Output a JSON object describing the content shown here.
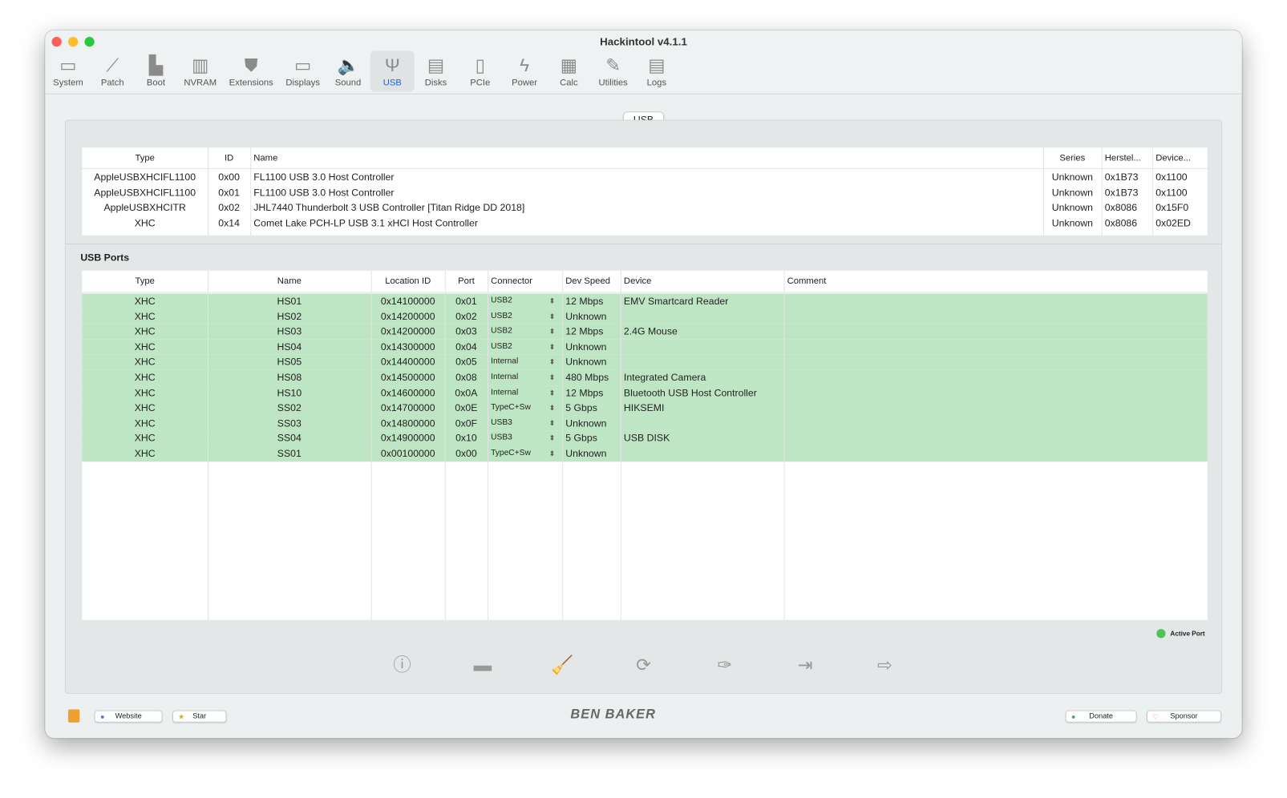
{
  "window": {
    "title": "Hackintool v4.1.1"
  },
  "toolbar": [
    {
      "label": "System",
      "icon": "system-icon",
      "g": "▭"
    },
    {
      "label": "Patch",
      "icon": "bandage-icon",
      "g": "⟋"
    },
    {
      "label": "Boot",
      "icon": "boot-icon",
      "g": "▙"
    },
    {
      "label": "NVRAM",
      "icon": "nvram-icon",
      "g": "▥"
    },
    {
      "label": "Extensions",
      "icon": "extensions-icon",
      "g": "⛊"
    },
    {
      "label": "Displays",
      "icon": "display-icon",
      "g": "▭"
    },
    {
      "label": "Sound",
      "icon": "speaker-icon",
      "g": "🔈"
    },
    {
      "label": "USB",
      "icon": "usb-icon",
      "g": "Ψ"
    },
    {
      "label": "Disks",
      "icon": "disk-icon",
      "g": "▤"
    },
    {
      "label": "PCIe",
      "icon": "pcie-icon",
      "g": "▯"
    },
    {
      "label": "Power",
      "icon": "power-icon",
      "g": "ϟ"
    },
    {
      "label": "Calc",
      "icon": "calculator-icon",
      "g": "▦"
    },
    {
      "label": "Utilities",
      "icon": "wrench-icon",
      "g": "✎"
    },
    {
      "label": "Logs",
      "icon": "logs-icon",
      "g": "▤"
    }
  ],
  "selected_tool": "USB",
  "tab_label": "USB",
  "controllers": {
    "columns": [
      "Type",
      "ID",
      "Name",
      "Series",
      "Herstel...",
      "Device..."
    ],
    "rows": [
      [
        "AppleUSBXHCIFL1100",
        "0x00",
        "FL1100 USB 3.0 Host Controller",
        "Unknown",
        "0x1B73",
        "0x1100"
      ],
      [
        "AppleUSBXHCIFL1100",
        "0x01",
        "FL1100 USB 3.0 Host Controller",
        "Unknown",
        "0x1B73",
        "0x1100"
      ],
      [
        "AppleUSBXHCITR",
        "0x02",
        "JHL7440 Thunderbolt 3 USB Controller [Titan Ridge DD 2018]",
        "Unknown",
        "0x8086",
        "0x15F0"
      ],
      [
        "XHC",
        "0x14",
        "Comet Lake PCH-LP USB 3.1 xHCI Host Controller",
        "Unknown",
        "0x8086",
        "0x02ED"
      ]
    ]
  },
  "ports": {
    "title": "USB Ports",
    "columns": [
      "Type",
      "Name",
      "Location ID",
      "Port",
      "Connector",
      "Dev Speed",
      "Device",
      "Comment"
    ],
    "rows": [
      [
        "XHC",
        "HS01",
        "0x14100000",
        "0x01",
        "USB2",
        "12 Mbps",
        "EMV Smartcard Reader",
        ""
      ],
      [
        "XHC",
        "HS02",
        "0x14200000",
        "0x02",
        "USB2",
        "Unknown",
        "",
        ""
      ],
      [
        "XHC",
        "HS03",
        "0x14200000",
        "0x03",
        "USB2",
        "12 Mbps",
        "2.4G Mouse",
        ""
      ],
      [
        "XHC",
        "HS04",
        "0x14300000",
        "0x04",
        "USB2",
        "Unknown",
        "",
        ""
      ],
      [
        "XHC",
        "HS05",
        "0x14400000",
        "0x05",
        "Internal",
        "Unknown",
        "",
        ""
      ],
      [
        "XHC",
        "HS08",
        "0x14500000",
        "0x08",
        "Internal",
        "480 Mbps",
        "Integrated Camera",
        ""
      ],
      [
        "XHC",
        "HS10",
        "0x14600000",
        "0x0A",
        "Internal",
        "12 Mbps",
        "Bluetooth USB Host Controller",
        ""
      ],
      [
        "XHC",
        "SS02",
        "0x14700000",
        "0x0E",
        "TypeC+Sw",
        "5 Gbps",
        "HIKSEMI",
        ""
      ],
      [
        "XHC",
        "SS03",
        "0x14800000",
        "0x0F",
        "USB3",
        "Unknown",
        "",
        ""
      ],
      [
        "XHC",
        "SS04",
        "0x14900000",
        "0x10",
        "USB3",
        "5 Gbps",
        "USB DISK",
        ""
      ],
      [
        "XHC",
        "SS01",
        "0x00100000",
        "0x00",
        "TypeC+Sw",
        "Unknown",
        "",
        ""
      ]
    ],
    "active_color": "#bfe6c4"
  },
  "legend": {
    "active_port": "Active Port"
  },
  "footer": {
    "website": "Website",
    "star": "Star",
    "logo": "BEN BAKER",
    "donate": "Donate",
    "sponsor": "Sponsor"
  }
}
